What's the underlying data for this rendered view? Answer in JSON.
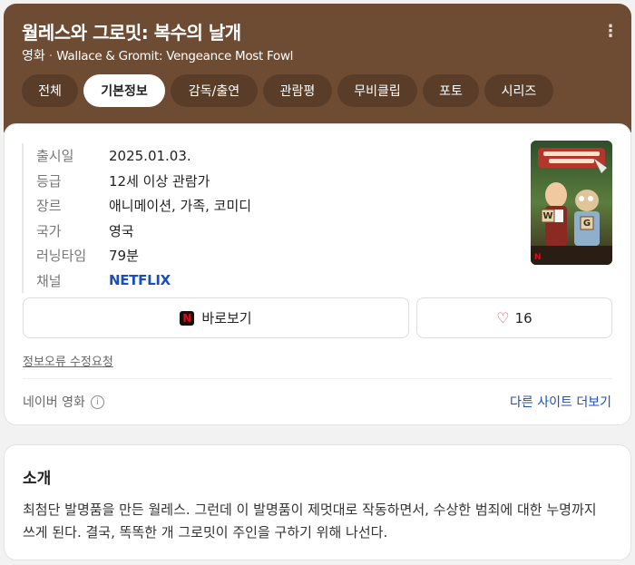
{
  "header": {
    "title": "월레스와 그로밋: 복수의 날개",
    "category": "영화",
    "separator": "·",
    "original_title": "Wallace & Gromit: Vengeance Most Fowl",
    "more_icon": "more-vertical-icon",
    "background_color": "#6e4b33"
  },
  "tabs": [
    {
      "label": "전체",
      "active": false
    },
    {
      "label": "기본정보",
      "active": true
    },
    {
      "label": "감독/출연",
      "active": false
    },
    {
      "label": "관람평",
      "active": false
    },
    {
      "label": "무비클립",
      "active": false
    },
    {
      "label": "포토",
      "active": false
    },
    {
      "label": "시리즈",
      "active": false
    }
  ],
  "info": {
    "rows": [
      {
        "label": "출시일",
        "value": "2025.01.03."
      },
      {
        "label": "등급",
        "value": "12세 이상 관람가"
      },
      {
        "label": "장르",
        "value": "애니메이션, 가족, 코미디"
      },
      {
        "label": "국가",
        "value": "영국"
      },
      {
        "label": "러닝타임",
        "value": "79분"
      },
      {
        "label": "채널",
        "value": "NETFLIX"
      }
    ]
  },
  "poster": {
    "badge_letter": "N",
    "block_letters": [
      "W",
      "G"
    ]
  },
  "actions": {
    "watch_label": "바로보기",
    "watch_badge": "N",
    "like_count": "16"
  },
  "footer": {
    "report_label": "정보오류 수정요청",
    "source_label": "네이버 영화",
    "info_icon_glyph": "i",
    "other_sites_label": "다른 사이트 더보기"
  },
  "intro": {
    "title": "소개",
    "text": "최첨단 발명품을 만든 월레스. 그런데 이 발명품이 제멋대로 작동하면서, 수상한 범죄에 대한 누명까지 쓰게 된다. 결국, 똑똑한 개 그로밋이 주인을 구하기 위해 나선다."
  },
  "colors": {
    "link_blue": "#1a4dbf",
    "heart_red": "#e83c4a",
    "netflix_red": "#e50914"
  }
}
